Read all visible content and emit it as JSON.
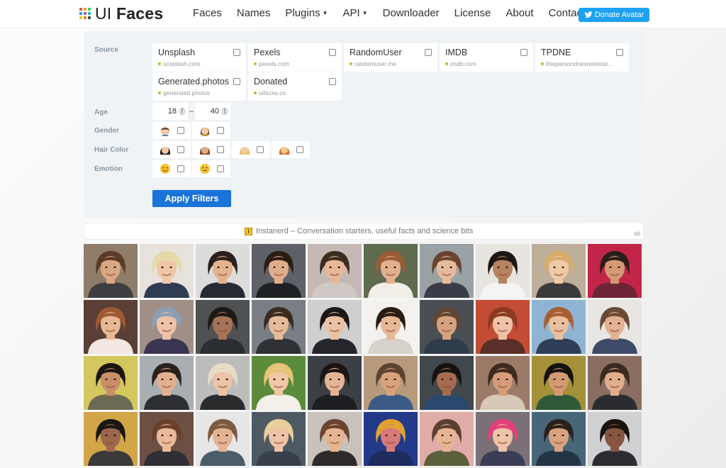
{
  "header": {
    "logo_light": "UI",
    "logo_bold": "Faces",
    "nav": [
      {
        "label": "Faces",
        "dropdown": false
      },
      {
        "label": "Names",
        "dropdown": false
      },
      {
        "label": "Plugins",
        "dropdown": true
      },
      {
        "label": "API",
        "dropdown": true
      },
      {
        "label": "Downloader",
        "dropdown": false
      },
      {
        "label": "License",
        "dropdown": false
      },
      {
        "label": "About",
        "dropdown": false
      },
      {
        "label": "Contact",
        "dropdown": false
      }
    ],
    "donate_label": "Donate Avatar",
    "donate_icon": "twitter-bird-icon"
  },
  "filters": {
    "source_label": "Source",
    "sources": [
      {
        "name": "Unsplash",
        "url": "unsplash.com",
        "checked": false
      },
      {
        "name": "Pexels",
        "url": "pexels.com",
        "checked": false
      },
      {
        "name": "RandomUser",
        "url": "randomuser.me",
        "checked": false
      },
      {
        "name": "IMDB",
        "url": "imdb.com",
        "checked": false
      },
      {
        "name": "TPDNE",
        "url": "thispersondoesnotexist...",
        "checked": false
      },
      {
        "name": "Generated.photos",
        "url": "generated.photos",
        "checked": false
      },
      {
        "name": "Donated",
        "url": "uifaces.co",
        "checked": false
      }
    ],
    "age_label": "Age",
    "age_from": "18",
    "age_sep": "–",
    "age_to": "40",
    "gender_label": "Gender",
    "gender_options": [
      "man-emoji",
      "woman-emoji"
    ],
    "hair_label": "Hair Color",
    "hair_options": [
      "black-hair-emoji",
      "brown-hair-emoji",
      "blonde-hair-emoji",
      "red-hair-emoji"
    ],
    "emotion_label": "Emotion",
    "emotion_options": [
      "smiling-face-emoji",
      "neutral-face-emoji"
    ],
    "apply_label": "Apply Filters"
  },
  "ad": {
    "text": "Instanerd – Conversation starters, useful facts and science bits",
    "tag": "ad",
    "icon": "instanerd-logo-icon"
  },
  "colors": {
    "accent": "#1a73d9",
    "donate": "#1da1f2",
    "panel": "#eff3f6",
    "status_dot": "#9acd32"
  },
  "faces": [
    {
      "bg": "#8f7c6a",
      "skin": "#d9a782",
      "hair": "#5a3b26",
      "shirt": "#3d3d42"
    },
    {
      "bg": "#e7e2dc",
      "skin": "#efc7a6",
      "hair": "#e5d9a8",
      "shirt": "#2f3c52"
    },
    {
      "bg": "#dcdcdc",
      "skin": "#e3b38e",
      "hair": "#2a211c",
      "shirt": "#262a33"
    },
    {
      "bg": "#5e6168",
      "skin": "#e0ad8a",
      "hair": "#2b1d14",
      "shirt": "#1f2023"
    },
    {
      "bg": "#c4b9b4",
      "skin": "#e7b898",
      "hair": "#3d2b20",
      "shirt": "#cfc8c4"
    },
    {
      "bg": "#5f6a4e",
      "skin": "#e3b08f",
      "hair": "#9a5b35",
      "shirt": "#f2efe8"
    },
    {
      "bg": "#9aa2a6",
      "skin": "#e6bb9b",
      "hair": "#6b4330",
      "shirt": "#3a3d47"
    },
    {
      "bg": "#e7e4df",
      "skin": "#b88361",
      "hair": "#1d1714",
      "shirt": "#f4f4f4"
    },
    {
      "bg": "#bfae9a",
      "skin": "#f0c9a6",
      "hair": "#d7ad6d",
      "shirt": "#3a3a3a"
    },
    {
      "bg": "#c3254a",
      "skin": "#d39a74",
      "hair": "#2b1e19",
      "shirt": "#6e2437"
    },
    {
      "bg": "#5a3f36",
      "skin": "#e8b894",
      "hair": "#9f5a33",
      "shirt": "#f3e9e2"
    },
    {
      "bg": "#a08f86",
      "skin": "#eec2a6",
      "hair": "#8a9fb5",
      "shirt": "#3a3550"
    },
    {
      "bg": "#4f5153",
      "skin": "#a87258",
      "hair": "#1e1915",
      "shirt": "#2b2e33"
    },
    {
      "bg": "#7a7f86",
      "skin": "#e6bb9a",
      "hair": "#3a2a20",
      "shirt": "#2f3136"
    },
    {
      "bg": "#cfcfcf",
      "skin": "#eac1a3",
      "hair": "#1d1714",
      "shirt": "#24262b"
    },
    {
      "bg": "#f4f2ef",
      "skin": "#e8b896",
      "hair": "#2a1c15",
      "shirt": "#d7d2cb"
    },
    {
      "bg": "#4a4f55",
      "skin": "#d7a37f",
      "hair": "#5d4634",
      "shirt": "#2e3b4a"
    },
    {
      "bg": "#c24d34",
      "skin": "#efc2a6",
      "hair": "#8b3a22",
      "shirt": "#5a2f2a"
    },
    {
      "bg": "#8fb4d3",
      "skin": "#eabf9d",
      "hair": "#a85e33",
      "shirt": "#2f3f58"
    },
    {
      "bg": "#e8e6e3",
      "skin": "#e2b191",
      "hair": "#6a4a37",
      "shirt": "#3e4a67"
    },
    {
      "bg": "#d4c75e",
      "skin": "#c98f69",
      "hair": "#1c1613",
      "shirt": "#6b6a54"
    },
    {
      "bg": "#a9aeb2",
      "skin": "#e2b08f",
      "hair": "#2a211b",
      "shirt": "#2d2f33"
    },
    {
      "bg": "#bcbcbc",
      "skin": "#ecc3a5",
      "hair": "#e6ddc6",
      "shirt": "#2b2c2e"
    },
    {
      "bg": "#5b8c3b",
      "skin": "#f0c8a6",
      "hair": "#e5c477",
      "shirt": "#f3f0e9"
    },
    {
      "bg": "#3c3f44",
      "skin": "#e4b595",
      "hair": "#1a1512",
      "shirt": "#1e1f22"
    },
    {
      "bg": "#b79a7b",
      "skin": "#d8a27d",
      "hair": "#5c4331",
      "shirt": "#3b5a86"
    },
    {
      "bg": "#41474b",
      "skin": "#a56b4e",
      "hair": "#16120f",
      "shirt": "#29496e"
    },
    {
      "bg": "#9b7b68",
      "skin": "#d69c7a",
      "hair": "#3d2b20",
      "shirt": "#d8c8b8"
    },
    {
      "bg": "#a39038",
      "skin": "#d39b73",
      "hair": "#15110e",
      "shirt": "#2e5a3b"
    },
    {
      "bg": "#8a6e62",
      "skin": "#e1ad8c",
      "hair": "#3a2a20",
      "shirt": "#2a2c30"
    },
    {
      "bg": "#d2a647",
      "skin": "#9c674d",
      "hair": "#1a1614",
      "shirt": "#3a3a3a"
    },
    {
      "bg": "#6d4f44",
      "skin": "#eab99a",
      "hair": "#6b3f2a",
      "shirt": "#2f2f35"
    },
    {
      "bg": "#e6e6e6",
      "skin": "#e4b292",
      "hair": "#7c5a3e",
      "shirt": "#4b5c6a"
    },
    {
      "bg": "#4e5a63",
      "skin": "#efc4a6",
      "hair": "#e8cf9a",
      "shirt": "#38404a"
    },
    {
      "bg": "#c7c2bb",
      "skin": "#e6b491",
      "hair": "#6a4331",
      "shirt": "#2f2a2a"
    },
    {
      "bg": "#233a8a",
      "skin": "#d77b7a",
      "hair": "#e0a32d",
      "shirt": "#1d2b5e"
    },
    {
      "bg": "#e0acaa",
      "skin": "#e6b594",
      "hair": "#5b4030",
      "shirt": "#5b5f3c"
    },
    {
      "bg": "#7b6f78",
      "skin": "#eec2a6",
      "hair": "#e1417b",
      "shirt": "#3a3d55"
    },
    {
      "bg": "#476778",
      "skin": "#d9a280",
      "hair": "#2a201a",
      "shirt": "#243447"
    },
    {
      "bg": "#cfd1d3",
      "skin": "#875640",
      "hair": "#1a1410",
      "shirt": "#2b2d33"
    }
  ]
}
